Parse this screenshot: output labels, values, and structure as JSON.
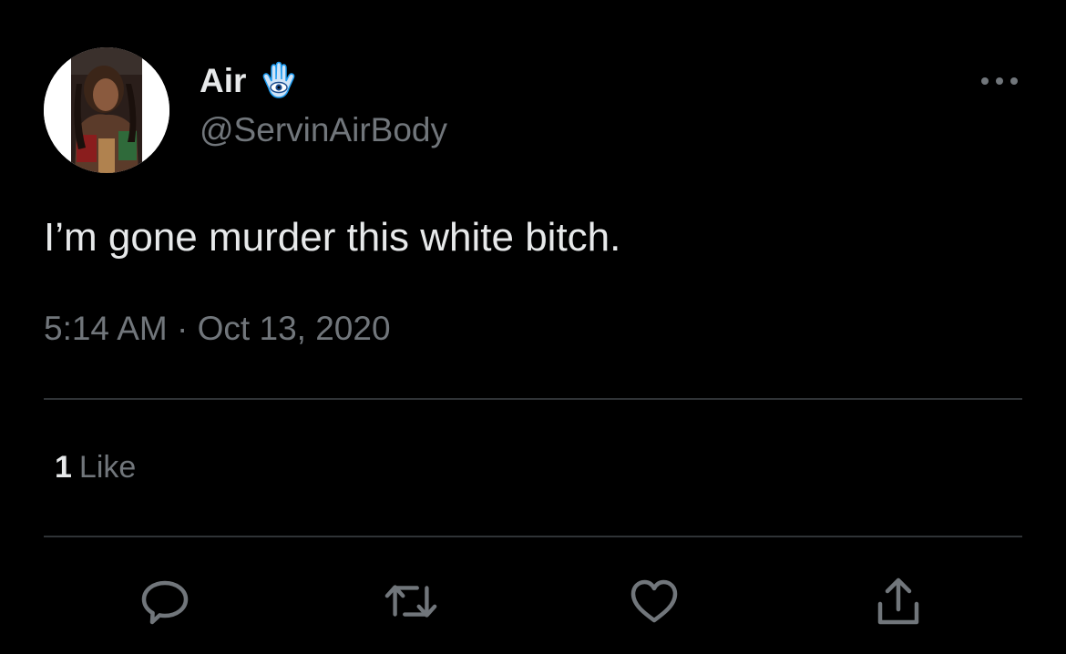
{
  "user": {
    "display_name": "Air",
    "badge_icon": "hamsa-hand-icon",
    "handle": "@ServinAirBody"
  },
  "tweet": {
    "text": "I’m gone murder this white bitch.",
    "time": "5:14 AM",
    "separator": "·",
    "date": "Oct 13, 2020"
  },
  "stats": {
    "likes_count": "1",
    "likes_label": "Like"
  },
  "actions": {
    "reply_icon": "reply-icon",
    "retweet_icon": "retweet-icon",
    "like_icon": "heart-icon",
    "share_icon": "share-icon",
    "more_icon": "more-options-icon"
  },
  "colors": {
    "background": "#000000",
    "primary_text": "#e7e9ea",
    "secondary_text": "#71767b",
    "divider": "#2f3336",
    "badge_blue": "#1d9bf0"
  }
}
